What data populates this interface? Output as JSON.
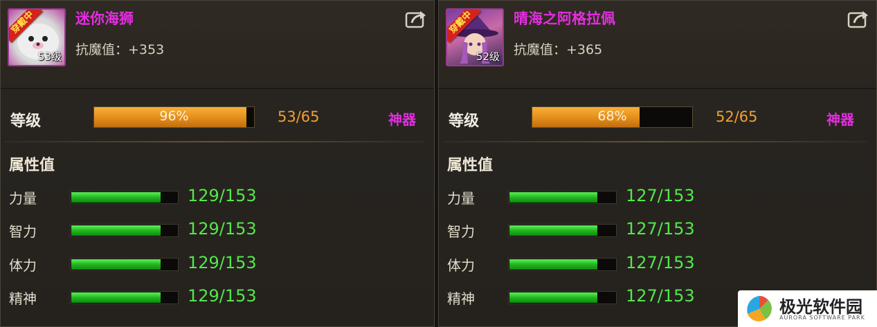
{
  "cards": [
    {
      "badge": "穿戴中",
      "avatar": "seal-avatar",
      "level_badge": "53级",
      "name": "迷你海狮",
      "resist": "抗魔值：+353",
      "level_label": "等级",
      "xp_percent_text": "96%",
      "xp_fraction": 0.96,
      "level_value": "53/65",
      "artifact_label": "神器",
      "attr_title": "属性值",
      "attrs": [
        {
          "label": "力量",
          "value": "129/153",
          "fraction": 0.843
        },
        {
          "label": "智力",
          "value": "129/153",
          "fraction": 0.843
        },
        {
          "label": "体力",
          "value": "129/153",
          "fraction": 0.843
        },
        {
          "label": "精神",
          "value": "129/153",
          "fraction": 0.843
        }
      ]
    },
    {
      "badge": "穿戴中",
      "avatar": "witch-girl-avatar",
      "level_badge": "52级",
      "name": "晴海之阿格拉佩",
      "resist": "抗魔值：+365",
      "level_label": "等级",
      "xp_percent_text": "68%",
      "xp_fraction": 0.68,
      "level_value": "52/65",
      "artifact_label": "神器",
      "attr_title": "属性值",
      "attrs": [
        {
          "label": "力量",
          "value": "127/153",
          "fraction": 0.83
        },
        {
          "label": "智力",
          "value": "127/153",
          "fraction": 0.83
        },
        {
          "label": "体力",
          "value": "127/153",
          "fraction": 0.83
        },
        {
          "label": "精神",
          "value": "127/153",
          "fraction": 0.83
        }
      ]
    }
  ],
  "colors": {
    "name": "#e42ee0",
    "xp_fill": "#e6901c",
    "level_value": "#f0a032",
    "attr_fill": "#22b61e",
    "attr_value": "#53e84a"
  },
  "watermark": {
    "cn": "极光软件园",
    "en": "AURORA SOFTWARE PARK"
  }
}
